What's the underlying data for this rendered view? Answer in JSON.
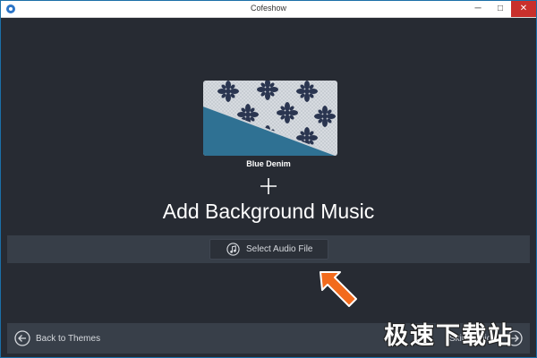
{
  "window": {
    "title": "Cofeshow",
    "controls": {
      "minimize": "─",
      "maximize": "□",
      "close": "✕"
    }
  },
  "theme": {
    "name": "Blue Denim",
    "colors": {
      "band": "#2f7193",
      "fabric": "#d9dde2",
      "print": "#2a3550"
    }
  },
  "main": {
    "plus_icon": "plus-icon",
    "heading": "Add Background Music",
    "select_button": {
      "icon": "music-note-icon",
      "label": "Select Audio File"
    }
  },
  "footer": {
    "back": {
      "icon": "arrow-left-circle-icon",
      "label": "Back to Themes"
    },
    "skip": {
      "label": "Skip Audio",
      "icon": "arrow-right-circle-icon"
    }
  },
  "watermark": "极速下载站",
  "colors": {
    "background": "#272b33",
    "band": "#373e48",
    "footer": "#383f49",
    "arrow": "#f26b1d",
    "close_button": "#c9302c"
  }
}
